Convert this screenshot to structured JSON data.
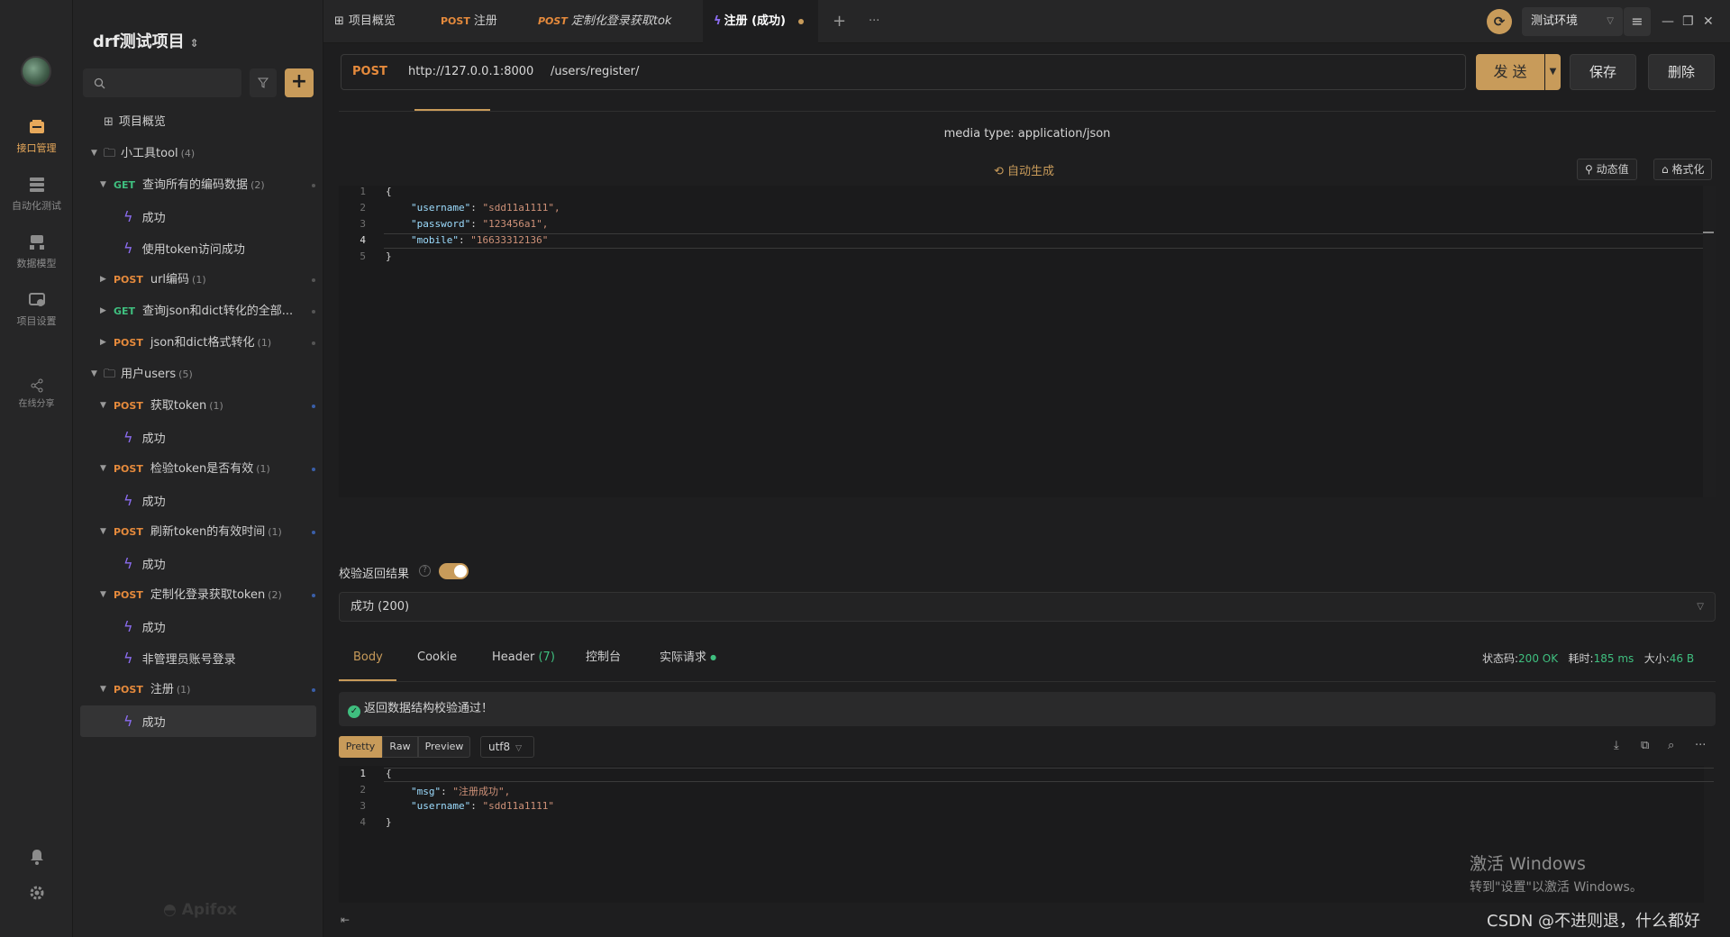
{
  "rail": {
    "items": [
      {
        "label": "接口管理",
        "icon": "api-management-icon"
      },
      {
        "label": "自动化测试",
        "icon": "automation-icon"
      },
      {
        "label": "数据模型",
        "icon": "data-model-icon"
      },
      {
        "label": "项目设置",
        "icon": "project-settings-icon"
      },
      {
        "label": "在线分享",
        "icon": "share-icon"
      }
    ]
  },
  "sidebar": {
    "project_title": "drf测试项目",
    "brand": "Apifox",
    "tree": [
      {
        "label": "项目概览"
      },
      {
        "label": "小工具tool",
        "count": "(4)"
      },
      {
        "method": "GET",
        "label": "查询所有的编码数据",
        "count": "(2)"
      },
      {
        "label": "成功"
      },
      {
        "label": "使用token访问成功"
      },
      {
        "method": "POST",
        "label": "url编码",
        "count": "(1)"
      },
      {
        "method": "GET",
        "label": "查询json和dict转化的全部..."
      },
      {
        "method": "POST",
        "label": "json和dict格式转化",
        "count": "(1)"
      },
      {
        "label": "用户users",
        "count": "(5)"
      },
      {
        "method": "POST",
        "label": "获取token",
        "count": "(1)"
      },
      {
        "label": "成功"
      },
      {
        "method": "POST",
        "label": "检验token是否有效",
        "count": "(1)"
      },
      {
        "label": "成功"
      },
      {
        "method": "POST",
        "label": "刷新token的有效时间",
        "count": "(1)"
      },
      {
        "label": "成功"
      },
      {
        "method": "POST",
        "label": "定制化登录获取token",
        "count": "(2)"
      },
      {
        "label": "成功"
      },
      {
        "label": "非管理员账号登录"
      },
      {
        "method": "POST",
        "label": "注册",
        "count": "(1)"
      },
      {
        "label": "成功"
      }
    ]
  },
  "tabs": [
    {
      "label": "项目概览"
    },
    {
      "method": "POST",
      "label": "注册"
    },
    {
      "method": "POST",
      "label": "定制化登录获取tok"
    },
    {
      "label": "注册 (成功)"
    }
  ],
  "env": {
    "label": "测试环境"
  },
  "request": {
    "method": "POST",
    "host": "http://127.0.0.1:8000",
    "path": "/users/register/",
    "send": "发 送",
    "save": "保存",
    "delete": "删除",
    "media_type": "media type: application/json",
    "auto_generate": "自动生成",
    "dynamic_value": "动态值",
    "format": "格式化",
    "body_lines": [
      "{",
      "\"username\": \"sdd11a1111\",",
      "\"password\": \"123456a1\",",
      "\"mobile\": \"16633312136\"",
      "}"
    ]
  },
  "validation": {
    "label": "校验返回结果",
    "enabled": true,
    "selected": "成功 (200)"
  },
  "response": {
    "tabs": [
      {
        "label": "Body"
      },
      {
        "label": "Cookie"
      },
      {
        "label": "Header",
        "count": "(7)"
      },
      {
        "label": "控制台"
      },
      {
        "label": "实际请求"
      }
    ],
    "status_label": "状态码:",
    "status_value": "200 OK",
    "time_label": "耗时:",
    "time_value": "185 ms",
    "size_label": "大小:",
    "size_value": "46 B",
    "pass_message": "返回数据结构校验通过！",
    "formats": [
      "Pretty",
      "Raw",
      "Preview"
    ],
    "encoding": "utf8",
    "body_lines": [
      "{",
      "\"msg\": \"注册成功\",",
      "\"username\": \"sdd11a1111\"",
      "}"
    ]
  },
  "overlay": {
    "win_activate_title": "激活 Windows",
    "win_activate_sub": "转到\"设置\"以激活 Windows。",
    "watermark": "CSDN @不进则退，什么都好"
  },
  "colors": {
    "accent": "#c89b5a",
    "get": "#3fbf7f",
    "post": "#e58a3c",
    "bolt": "#8b6cf0"
  }
}
